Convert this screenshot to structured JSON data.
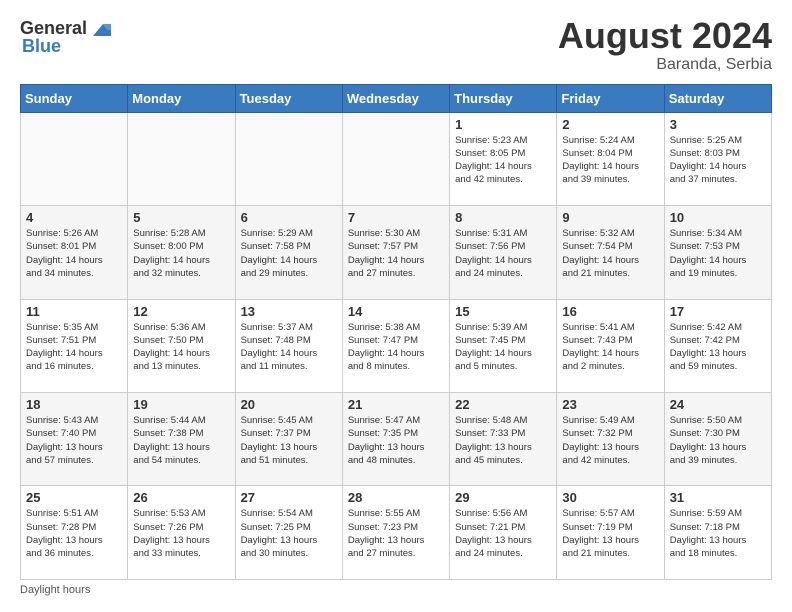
{
  "header": {
    "logo_general": "General",
    "logo_blue": "Blue",
    "month_year": "August 2024",
    "location": "Baranda, Serbia"
  },
  "days_of_week": [
    "Sunday",
    "Monday",
    "Tuesday",
    "Wednesday",
    "Thursday",
    "Friday",
    "Saturday"
  ],
  "footer": {
    "note": "Daylight hours"
  },
  "weeks": [
    [
      {
        "day": "",
        "info": ""
      },
      {
        "day": "",
        "info": ""
      },
      {
        "day": "",
        "info": ""
      },
      {
        "day": "",
        "info": ""
      },
      {
        "day": "1",
        "info": "Sunrise: 5:23 AM\nSunset: 8:05 PM\nDaylight: 14 hours\nand 42 minutes."
      },
      {
        "day": "2",
        "info": "Sunrise: 5:24 AM\nSunset: 8:04 PM\nDaylight: 14 hours\nand 39 minutes."
      },
      {
        "day": "3",
        "info": "Sunrise: 5:25 AM\nSunset: 8:03 PM\nDaylight: 14 hours\nand 37 minutes."
      }
    ],
    [
      {
        "day": "4",
        "info": "Sunrise: 5:26 AM\nSunset: 8:01 PM\nDaylight: 14 hours\nand 34 minutes."
      },
      {
        "day": "5",
        "info": "Sunrise: 5:28 AM\nSunset: 8:00 PM\nDaylight: 14 hours\nand 32 minutes."
      },
      {
        "day": "6",
        "info": "Sunrise: 5:29 AM\nSunset: 7:58 PM\nDaylight: 14 hours\nand 29 minutes."
      },
      {
        "day": "7",
        "info": "Sunrise: 5:30 AM\nSunset: 7:57 PM\nDaylight: 14 hours\nand 27 minutes."
      },
      {
        "day": "8",
        "info": "Sunrise: 5:31 AM\nSunset: 7:56 PM\nDaylight: 14 hours\nand 24 minutes."
      },
      {
        "day": "9",
        "info": "Sunrise: 5:32 AM\nSunset: 7:54 PM\nDaylight: 14 hours\nand 21 minutes."
      },
      {
        "day": "10",
        "info": "Sunrise: 5:34 AM\nSunset: 7:53 PM\nDaylight: 14 hours\nand 19 minutes."
      }
    ],
    [
      {
        "day": "11",
        "info": "Sunrise: 5:35 AM\nSunset: 7:51 PM\nDaylight: 14 hours\nand 16 minutes."
      },
      {
        "day": "12",
        "info": "Sunrise: 5:36 AM\nSunset: 7:50 PM\nDaylight: 14 hours\nand 13 minutes."
      },
      {
        "day": "13",
        "info": "Sunrise: 5:37 AM\nSunset: 7:48 PM\nDaylight: 14 hours\nand 11 minutes."
      },
      {
        "day": "14",
        "info": "Sunrise: 5:38 AM\nSunset: 7:47 PM\nDaylight: 14 hours\nand 8 minutes."
      },
      {
        "day": "15",
        "info": "Sunrise: 5:39 AM\nSunset: 7:45 PM\nDaylight: 14 hours\nand 5 minutes."
      },
      {
        "day": "16",
        "info": "Sunrise: 5:41 AM\nSunset: 7:43 PM\nDaylight: 14 hours\nand 2 minutes."
      },
      {
        "day": "17",
        "info": "Sunrise: 5:42 AM\nSunset: 7:42 PM\nDaylight: 13 hours\nand 59 minutes."
      }
    ],
    [
      {
        "day": "18",
        "info": "Sunrise: 5:43 AM\nSunset: 7:40 PM\nDaylight: 13 hours\nand 57 minutes."
      },
      {
        "day": "19",
        "info": "Sunrise: 5:44 AM\nSunset: 7:38 PM\nDaylight: 13 hours\nand 54 minutes."
      },
      {
        "day": "20",
        "info": "Sunrise: 5:45 AM\nSunset: 7:37 PM\nDaylight: 13 hours\nand 51 minutes."
      },
      {
        "day": "21",
        "info": "Sunrise: 5:47 AM\nSunset: 7:35 PM\nDaylight: 13 hours\nand 48 minutes."
      },
      {
        "day": "22",
        "info": "Sunrise: 5:48 AM\nSunset: 7:33 PM\nDaylight: 13 hours\nand 45 minutes."
      },
      {
        "day": "23",
        "info": "Sunrise: 5:49 AM\nSunset: 7:32 PM\nDaylight: 13 hours\nand 42 minutes."
      },
      {
        "day": "24",
        "info": "Sunrise: 5:50 AM\nSunset: 7:30 PM\nDaylight: 13 hours\nand 39 minutes."
      }
    ],
    [
      {
        "day": "25",
        "info": "Sunrise: 5:51 AM\nSunset: 7:28 PM\nDaylight: 13 hours\nand 36 minutes."
      },
      {
        "day": "26",
        "info": "Sunrise: 5:53 AM\nSunset: 7:26 PM\nDaylight: 13 hours\nand 33 minutes."
      },
      {
        "day": "27",
        "info": "Sunrise: 5:54 AM\nSunset: 7:25 PM\nDaylight: 13 hours\nand 30 minutes."
      },
      {
        "day": "28",
        "info": "Sunrise: 5:55 AM\nSunset: 7:23 PM\nDaylight: 13 hours\nand 27 minutes."
      },
      {
        "day": "29",
        "info": "Sunrise: 5:56 AM\nSunset: 7:21 PM\nDaylight: 13 hours\nand 24 minutes."
      },
      {
        "day": "30",
        "info": "Sunrise: 5:57 AM\nSunset: 7:19 PM\nDaylight: 13 hours\nand 21 minutes."
      },
      {
        "day": "31",
        "info": "Sunrise: 5:59 AM\nSunset: 7:18 PM\nDaylight: 13 hours\nand 18 minutes."
      }
    ]
  ]
}
